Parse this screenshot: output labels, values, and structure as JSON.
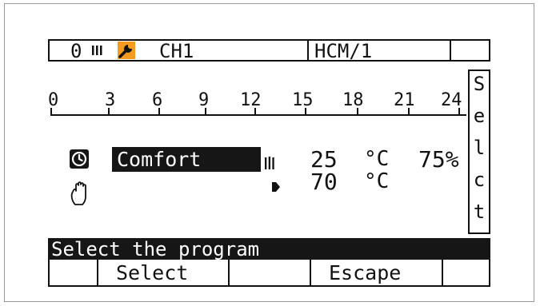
{
  "header": {
    "mode_code": "0",
    "channel": "CH1",
    "module": "HCM/1"
  },
  "scale": {
    "ticks": [
      "0",
      "3",
      "6",
      "9",
      "12",
      "15",
      "18",
      "21",
      "24"
    ]
  },
  "program": {
    "label": "Comfort",
    "room_temp": "25",
    "room_temp_unit": "°C",
    "humidity": "75%",
    "flow_temp": "70",
    "flow_temp_unit": "°C"
  },
  "side_button": {
    "letters": [
      "S",
      "e",
      "l",
      "c",
      "t"
    ]
  },
  "status": {
    "text": "Select the program"
  },
  "softkeys": {
    "select": "Select",
    "escape": "Escape"
  },
  "icons": {
    "clock": "clock-icon",
    "hand": "manual-hand-icon",
    "wrench": "wrench-icon",
    "radiator": "radiator-icon",
    "flow": "flow-arrow-icon"
  },
  "colors": {
    "accent": "#f29b1e",
    "lcd_ink": "#161616",
    "lcd_bg": "#ffffff"
  }
}
